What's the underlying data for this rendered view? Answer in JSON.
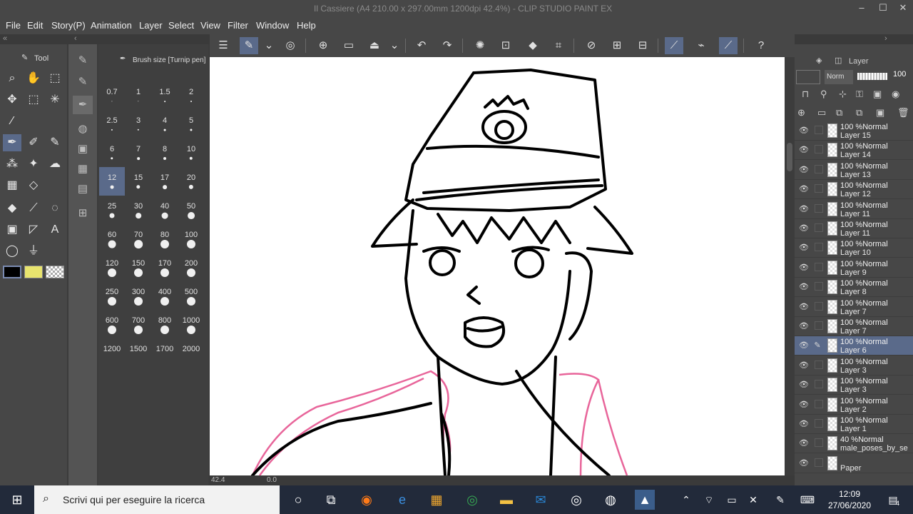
{
  "window": {
    "title": "Il Cassiere (A4 210.00 x 297.00mm 1200dpi 42.4%)  - CLIP STUDIO PAINT EX",
    "buttons": [
      "–",
      "☐",
      "✕"
    ]
  },
  "menu": [
    "File",
    "Edit",
    "Story(P)",
    "Animation",
    "Layer",
    "Select",
    "View",
    "Filter",
    "Window",
    "Help"
  ],
  "tool_panel": {
    "tab_label": "Tool"
  },
  "brush_panel": {
    "header": "Brush size [Turnip pen]",
    "sizes": [
      "0.7",
      "1",
      "1.5",
      "2",
      "2.5",
      "3",
      "4",
      "5",
      "6",
      "7",
      "8",
      "10",
      "12",
      "15",
      "17",
      "20",
      "25",
      "30",
      "40",
      "50",
      "60",
      "70",
      "80",
      "100",
      "120",
      "150",
      "170",
      "200",
      "250",
      "300",
      "400",
      "500",
      "600",
      "700",
      "800",
      "1000",
      "1200",
      "1500",
      "1700",
      "2000"
    ],
    "selected": "12"
  },
  "layer_panel": {
    "tab_label": "Layer",
    "blend_mode": "Norm",
    "opacity": "100",
    "layers": [
      {
        "t1": "100 %Normal",
        "t2": "Layer 15"
      },
      {
        "t1": "100 %Normal",
        "t2": "Layer 14"
      },
      {
        "t1": "100 %Normal",
        "t2": "Layer 13"
      },
      {
        "t1": "100 %Normal",
        "t2": "Layer 12"
      },
      {
        "t1": "100 %Normal",
        "t2": "Layer 11"
      },
      {
        "t1": "100 %Normal",
        "t2": "Layer 11"
      },
      {
        "t1": "100 %Normal",
        "t2": "Layer 10"
      },
      {
        "t1": "100 %Normal",
        "t2": "Layer 9"
      },
      {
        "t1": "100 %Normal",
        "t2": "Layer 8"
      },
      {
        "t1": "100 %Normal",
        "t2": "Layer 7"
      },
      {
        "t1": "100 %Normal",
        "t2": "Layer 7"
      },
      {
        "t1": "100 %Normal",
        "t2": "Layer 6"
      },
      {
        "t1": "100 %Normal",
        "t2": "Layer 3"
      },
      {
        "t1": "100 %Normal",
        "t2": "Layer 3"
      },
      {
        "t1": "100 %Normal",
        "t2": "Layer 2"
      },
      {
        "t1": "100 %Normal",
        "t2": "Layer 1"
      },
      {
        "t1": "40 %Normal",
        "t2": "male_poses_by_se"
      },
      {
        "t1": "",
        "t2": "Paper"
      }
    ]
  },
  "status": {
    "zoom": "42.4",
    "angle": "0.0"
  },
  "taskbar": {
    "search_placeholder": "Scrivi qui per eseguire la ricerca",
    "time": "12:09",
    "date": "27/06/2020",
    "notification_count": "4"
  }
}
